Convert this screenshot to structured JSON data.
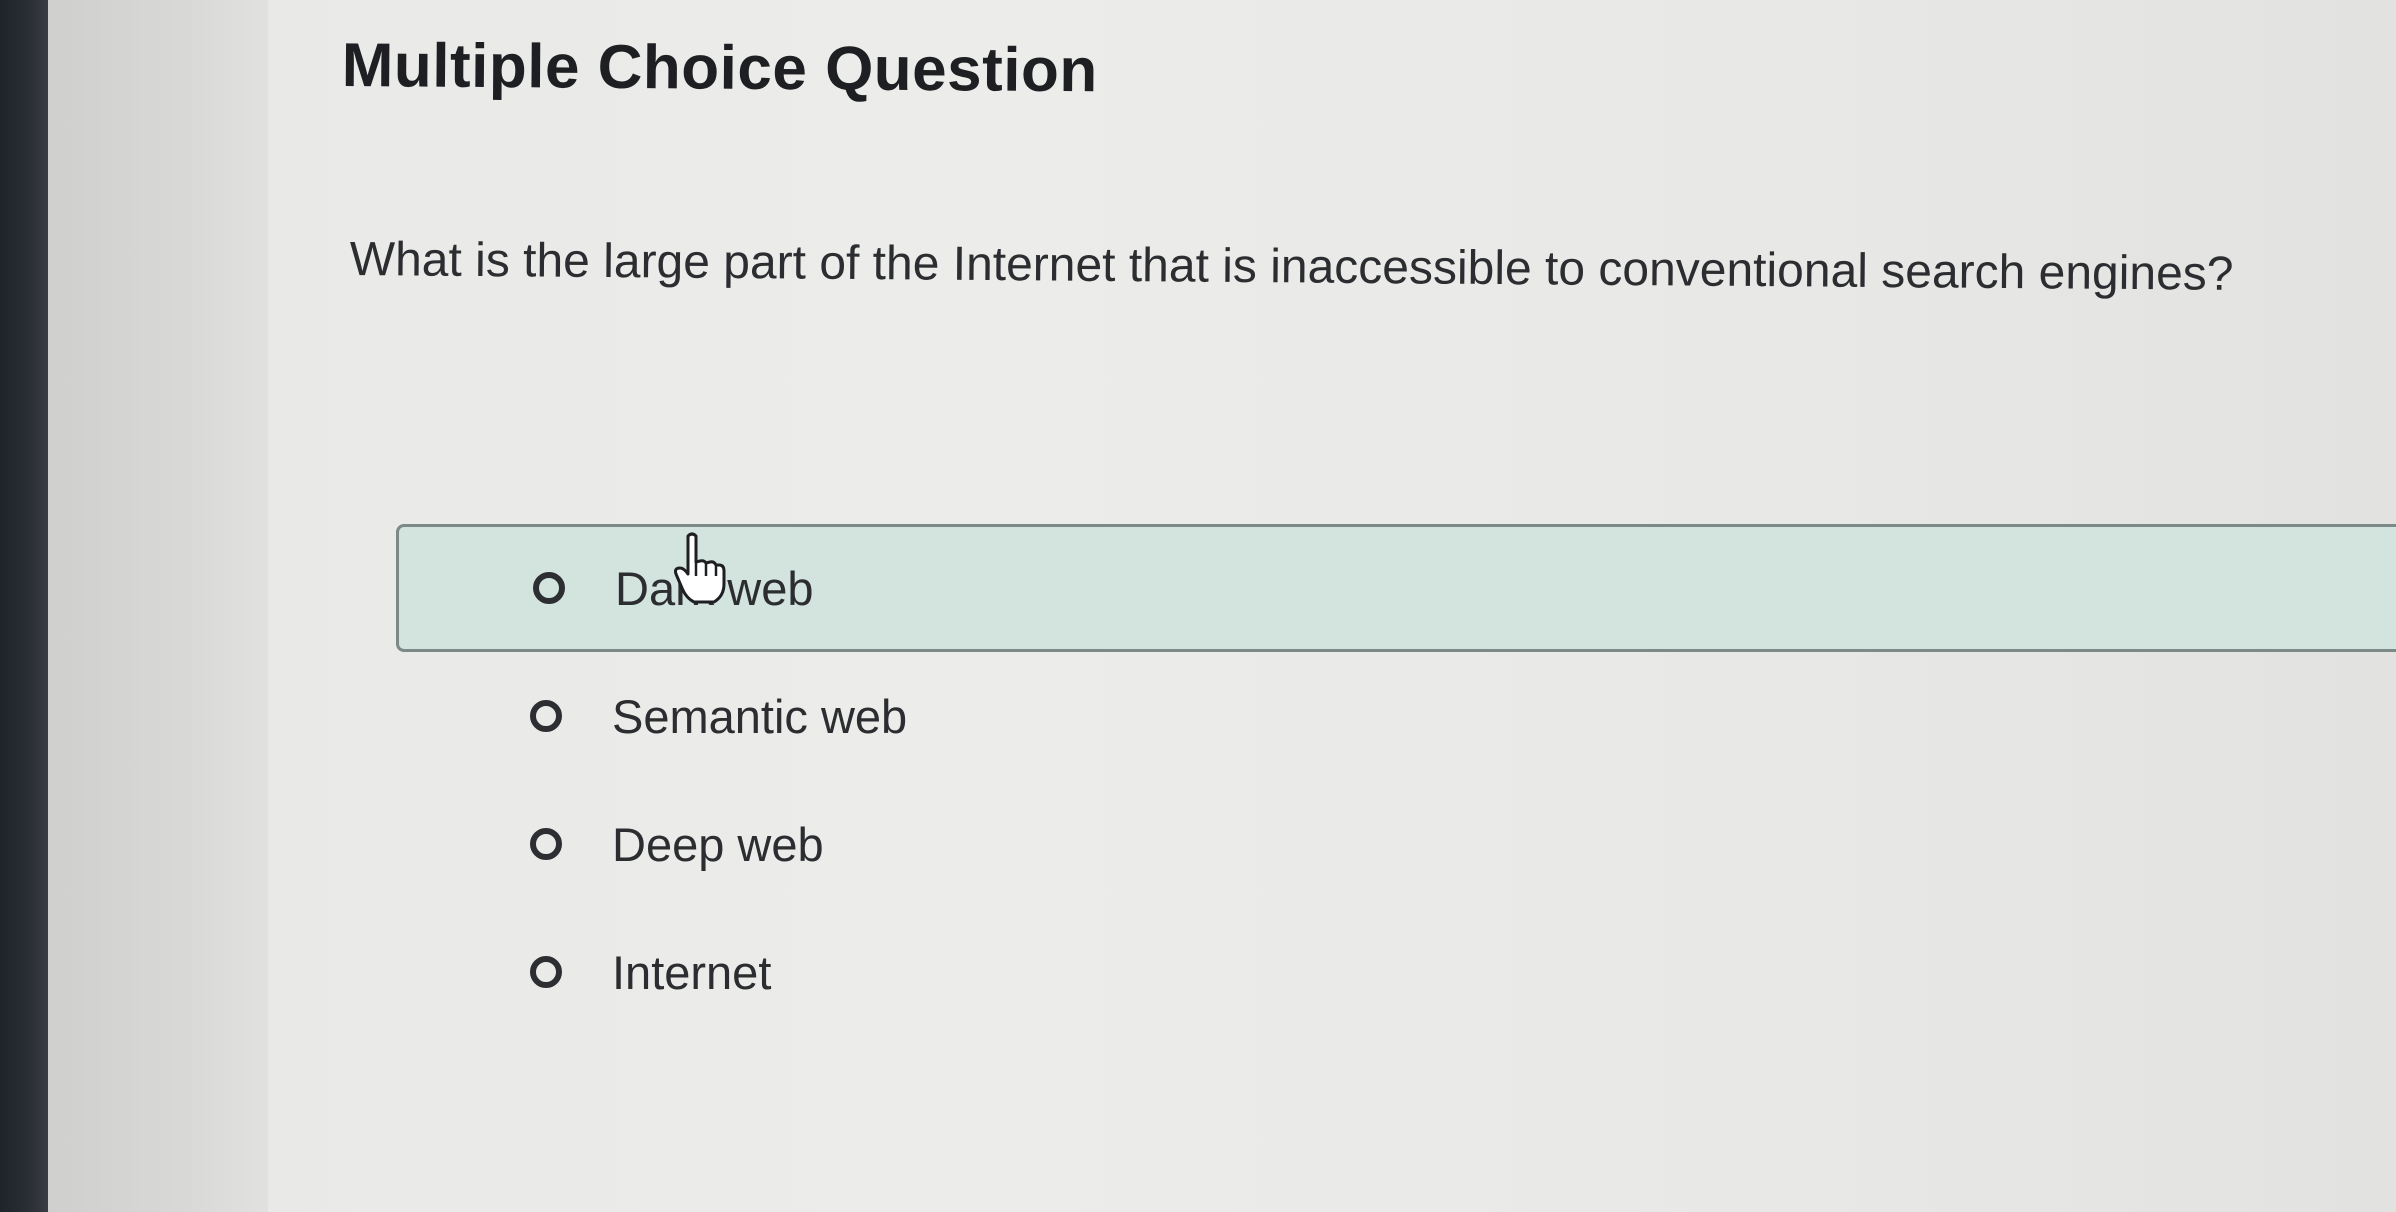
{
  "page": {
    "heading": "Multiple Choice Question",
    "question": "What is the large part of the Internet that is inaccessible to conventional search engines?"
  },
  "options": [
    {
      "label": "Dark web",
      "hovered": true
    },
    {
      "label": "Semantic web",
      "hovered": false
    },
    {
      "label": "Deep web",
      "hovered": false
    },
    {
      "label": "Internet",
      "hovered": false
    }
  ],
  "cursor": {
    "icon": "hand-pointer-icon"
  },
  "colors": {
    "hover_background": "#d3e3de",
    "hover_border": "#7b8a87",
    "text": "#2b2d30"
  }
}
